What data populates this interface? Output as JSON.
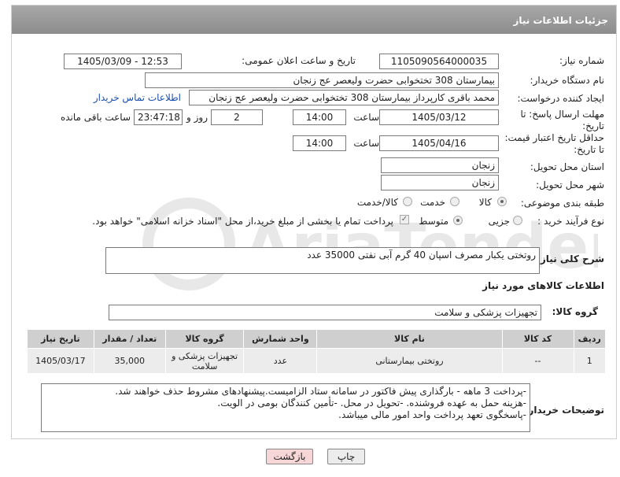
{
  "header": {
    "title": "جزئیات اطلاعات نیاز"
  },
  "fields": {
    "need_number_label": "شماره نیاز:",
    "need_number": "1105090564000035",
    "announce_label": "تاریخ و ساعت اعلان عمومی:",
    "announce_value": "1405/03/09 - 12:53",
    "buyer_org_label": "نام دستگاه خریدار:",
    "buyer_org": "بیمارستان 308 تختخوابی حضرت ولیعصر عج  زنجان",
    "requester_label": "ایجاد کننده درخواست:",
    "requester": "محمد باقری کارپرداز بیمارستان 308 تختخوابی حضرت ولیعصر عج  زنجان",
    "buyer_contact_link": "اطلاعات تماس خریدار",
    "deadline_label": "مهلت ارسال پاسخ: تا تاریخ:",
    "deadline_date": "1405/03/12",
    "time_label": "ساعت",
    "deadline_time": "14:00",
    "days_value": "2",
    "days_label": "روز و",
    "remaining_time": "23:47:18",
    "remaining_label": "ساعت باقی مانده",
    "validity_label": "حداقل تاریخ اعتبار قیمت: تا تاریخ:",
    "validity_date": "1405/04/16",
    "validity_time": "14:00",
    "province_label": "استان محل تحویل:",
    "province": "زنجان",
    "city_label": "شهر محل تحویل:",
    "city": "زنجان",
    "category_label": "طبقه بندی موضوعی:",
    "category_options": [
      "کالا",
      "خدمت",
      "کالا/خدمت"
    ],
    "process_label": "نوع فرآیند خرید :",
    "process_options": [
      "جزیی",
      "متوسط"
    ],
    "payment_note": "پرداخت تمام یا بخشی از مبلغ خرید،از محل \"اسناد خزانه اسلامی\" خواهد بود."
  },
  "description": {
    "label": "شرح کلی نیاز:",
    "value": "روتختی یکبار مصرف اسپان 40 گرم  آبی نفتی 35000 عدد"
  },
  "goods_section": {
    "title": "اطلاعات کالاهای مورد نیاز",
    "group_label": "گروه کالا:",
    "group_value": "تجهیزات پزشکی و سلامت",
    "columns": [
      "ردیف",
      "کد کالا",
      "نام کالا",
      "واحد شمارش",
      "گروه کالا",
      "تعداد / مقدار",
      "تاریخ نیاز"
    ],
    "rows": [
      [
        "1",
        "--",
        "روتختی بیمارستانی",
        "عدد",
        "تجهیزات پزشکی و سلامت",
        "35,000",
        "1405/03/17"
      ]
    ]
  },
  "buyer_notes": {
    "label": "توضیحات خریدار:",
    "lines": [
      "-پرداخت  3 ماهه - بارگذاری پیش فاکتور در سامانه ستاد الزامیست.پیشنهادهای مشروط حذف خواهند شد.",
      "-هزینه حمل به عهده فروشنده. -تحویل در محل. -تأمین کنندگان بومی در الویت.",
      "-پاسخگوی تعهد پرداخت واحد امور مالی میباشد."
    ]
  },
  "buttons": {
    "print": "چاپ",
    "back": "بازگشت"
  },
  "colors": {
    "header": "#9a9a9a",
    "link": "#1a4fb0",
    "back_button": "#f6d6d6",
    "print_button": "#ececec"
  }
}
